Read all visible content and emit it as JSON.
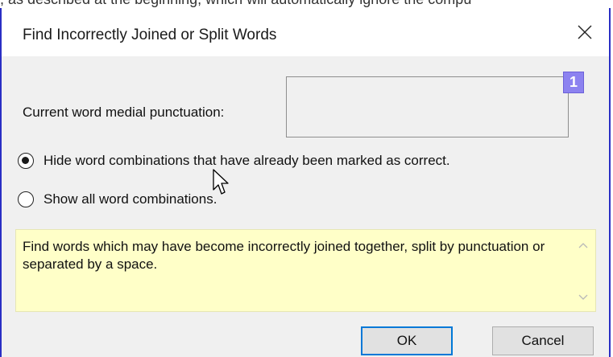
{
  "background_text": ", as described at the beginning, which will automatically ignore the compu",
  "dialog": {
    "title": "Find Incorrectly Joined or Split Words",
    "close_icon": "close-icon"
  },
  "punctuation": {
    "label": "Current word medial punctuation:",
    "value": "",
    "badge": "1"
  },
  "options": {
    "hide_label": "Hide word combinations that have already been marked as correct.",
    "show_label": "Show all word combinations.",
    "selected": "hide"
  },
  "description": {
    "text": "Find words which may have become incorrectly joined together, split by punctuation or separated by a space."
  },
  "buttons": {
    "ok": "OK",
    "cancel": "Cancel"
  },
  "colors": {
    "window_border": "#2a2fc4",
    "description_bg": "#ffffc8",
    "badge_bg": "#8c82f0",
    "default_button_border": "#0078d7"
  }
}
